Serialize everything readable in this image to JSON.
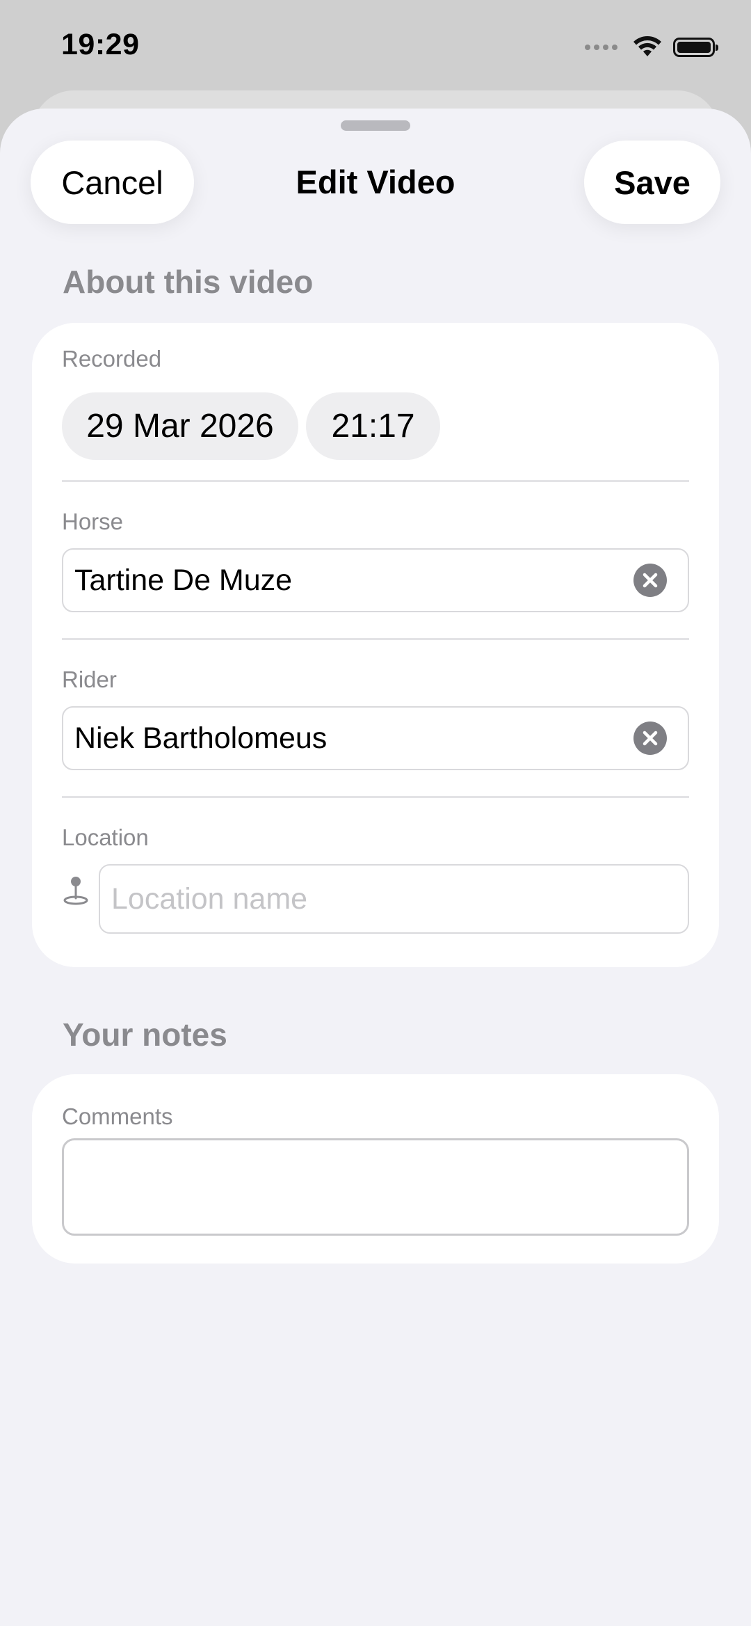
{
  "status_bar": {
    "time": "19:29",
    "icons": [
      "signal-dots-icon",
      "wifi-icon",
      "battery-icon"
    ]
  },
  "sheet": {
    "title": "Edit Video",
    "cancel_label": "Cancel",
    "save_label": "Save"
  },
  "about": {
    "header": "About this video",
    "recorded_label": "Recorded",
    "recorded_date": "29 Mar 2026",
    "recorded_time": "21:17",
    "horse_label": "Horse",
    "horse_value": "Tartine De Muze",
    "rider_label": "Rider",
    "rider_value": "Niek Bartholomeus",
    "location_label": "Location",
    "location_placeholder": "Location name",
    "location_value": ""
  },
  "notes": {
    "header": "Your notes",
    "comments_label": "Comments",
    "comments_value": ""
  },
  "colors": {
    "background": "#f2f2f7",
    "card": "#ffffff",
    "secondary_text": "#8a8a8e",
    "clear_button": "#7f7f84"
  }
}
